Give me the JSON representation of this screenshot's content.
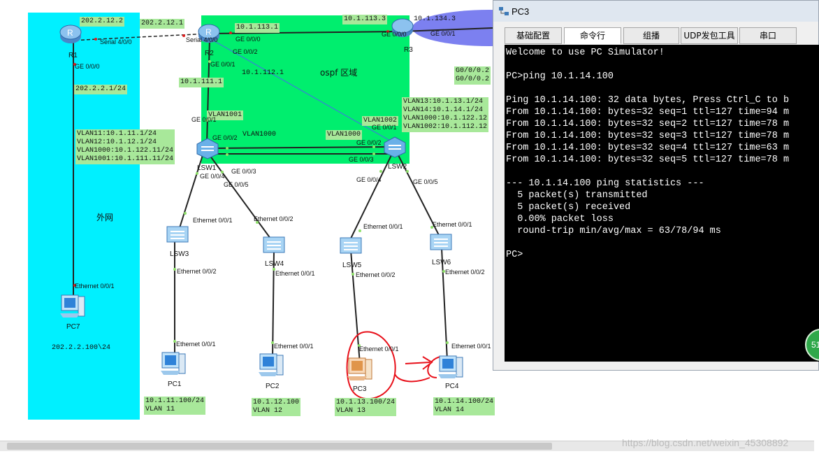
{
  "topology": {
    "zone_external_label": "外网",
    "zone_ospf_label": "ospf 区域",
    "colors": {
      "external": "#00f0ff",
      "ospf": "#00ee6e",
      "console_bg": "#000000",
      "link_box": "#a8e89a",
      "annotation": "#e8101a"
    },
    "devices": {
      "r1": "R1",
      "r2": "R2",
      "r3": "R3",
      "lsw1": "LSW1",
      "lsw2": "LSW2",
      "lsw3": "LSW3",
      "lsw4": "LSW4",
      "lsw5": "LSW5",
      "lsw6": "LSW6",
      "pc1": "PC1",
      "pc2": "PC2",
      "pc3": "PC3",
      "pc4": "PC4",
      "pc7": "PC7"
    },
    "boxes": {
      "b_202_2_12_2": "202.2.12.2",
      "b_202_2_12_1": "202.2.12.1",
      "b_10_1_113_1": "10.1.113.1",
      "b_10_1_113_3": "10.1.113.3",
      "b_10_1_134_3": "10.1.134.3",
      "b_10_1_111_1": "10.1.111.1",
      "b_10_1_112_1": "10.1.112.1",
      "b_202_2_2_1": "202.2.2.1/24",
      "b_lsw1_vlans": "VLAN11:10.1.11.1/24\nVLAN12:10.1.12.1/24\nVLAN1000:10.1.122.11/24\nVLAN1001:10.1.111.11/24",
      "b_lsw2_vlans": "VLAN13:10.1.13.1/24\nVLAN14:10.1.14.1/24\nVLAN1000:10.1.122.12\nVLAN1002:10.1.112.12",
      "b_r3_ports": "G0/0/0.2\nG0/0/0.2",
      "b_vlan1001": "VLAN1001",
      "b_vlan1000_a": "VLAN1000",
      "b_vlan1000_b": "VLAN1000",
      "b_vlan1002": "VLAN1002",
      "b_pc7": "202.2.2.100\\24",
      "b_pc1": "10.1.11.100/24\nVLAN 11",
      "b_pc2": "10.1.12.100\nVLAN 12",
      "b_pc3": "10.1.13.100/24\nVLAN 13",
      "b_pc4": "10.1.14.100/24\nVLAN 14"
    },
    "ports": {
      "r1_serial": "Serial 4/0/0",
      "r2_serial": "Serial 4/0/0",
      "r1_ge000": "GE 0/0/0",
      "r2_ge000": "GE 0/0/0",
      "r2_ge002": "GE 0/0/2",
      "r2_ge001": "GE 0/0/1",
      "r3_ge000": "GE 0/0/0",
      "r3_ge001": "GE 0/0/1",
      "lsw1_ge001": "GE 0/0/1",
      "lsw1_ge002": "GE 0/0/2",
      "lsw1_ge003": "GE 0/0/3",
      "lsw1_ge004": "GE 0/0/4",
      "lsw1_ge005": "GE 0/0/5",
      "lsw2_ge001": "GE 0/0/1",
      "lsw2_ge002": "GE 0/0/2",
      "lsw2_ge003": "GE 0/0/3",
      "lsw2_ge004": "GE 0/0/4",
      "lsw2_ge005": "GE 0/0/5",
      "lsw3_e001": "Ethernet 0/0/1",
      "lsw3_e002": "Ethernet 0/0/2",
      "lsw4_e002": "Ethernet 0/0/2",
      "lsw4_e001": "Ethernet 0/0/1",
      "lsw5_e001": "Ethernet 0/0/1",
      "lsw5_e002": "Ethernet 0/0/2",
      "lsw6_e001": "Ethernet 0/0/1",
      "lsw6_e002": "Ethernet 0/0/2",
      "pc1_e001": "Ethernet 0/0/1",
      "pc2_e001": "Ethernet 0/0/1",
      "pc3_e001": "Ethernet 0/0/1",
      "pc4_e001": "Ethernet 0/0/1",
      "pc7_e001": "Ethernet 0/0/1"
    }
  },
  "window": {
    "title": "PC3",
    "tabs": [
      "基础配置",
      "命令行",
      "组播",
      "UDP发包工具",
      "串口"
    ],
    "active_tab": "命令行",
    "console_text": "Welcome to use PC Simulator!\n\nPC>ping 10.1.14.100\n\nPing 10.1.14.100: 32 data bytes, Press Ctrl_C to b\nFrom 10.1.14.100: bytes=32 seq=1 ttl=127 time=94 m\nFrom 10.1.14.100: bytes=32 seq=2 ttl=127 time=78 m\nFrom 10.1.14.100: bytes=32 seq=3 ttl=127 time=78 m\nFrom 10.1.14.100: bytes=32 seq=4 ttl=127 time=63 m\nFrom 10.1.14.100: bytes=32 seq=5 ttl=127 time=78 m\n\n--- 10.1.14.100 ping statistics ---\n  5 packet(s) transmitted\n  5 packet(s) received\n  0.00% packet loss\n  round-trip min/avg/max = 63/78/94 ms\n\nPC>"
  },
  "badge": "51",
  "watermark": "https://blog.csdn.net/weixin_45308892"
}
